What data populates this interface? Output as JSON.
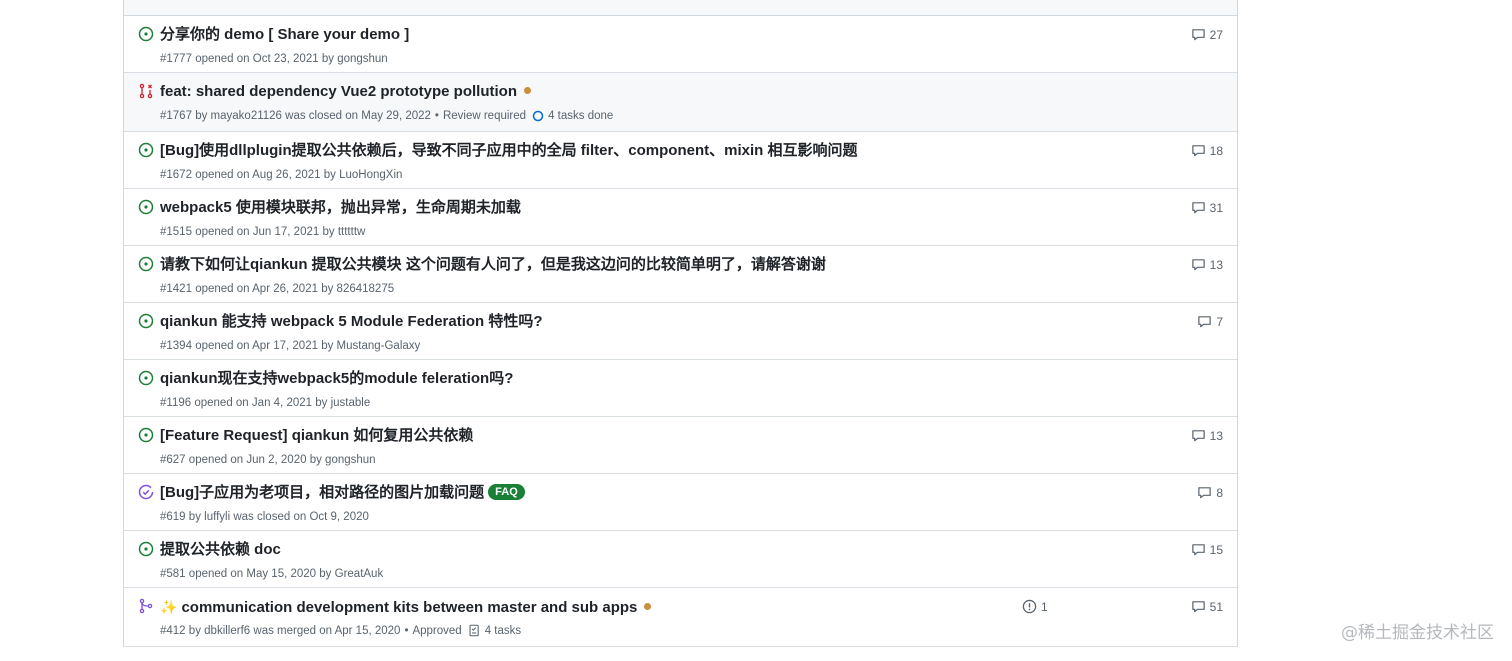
{
  "issues": [
    {
      "state": "open",
      "title": "分享你的 demo [ Share your demo ]",
      "number": "#1777",
      "verb": "opened on",
      "date": "Oct 23, 2021",
      "by": "by",
      "author": "gongshun",
      "comments": "27"
    },
    {
      "state": "pr-closed",
      "title": "feat: shared dependency Vue2 prototype pollution",
      "number": "#1767",
      "by": "by",
      "author": "mayako21126",
      "verb": "was closed on",
      "date": "May 29, 2022",
      "review": "Review required",
      "tasks": "4 tasks done",
      "has_dot": true
    },
    {
      "state": "open",
      "title": "[Bug]使用dllplugin提取公共依赖后，导致不同子应用中的全局 filter、component、mixin 相互影响问题",
      "number": "#1672",
      "verb": "opened on",
      "date": "Aug 26, 2021",
      "by": "by",
      "author": "LuoHongXin",
      "comments": "18"
    },
    {
      "state": "open",
      "title": "webpack5 使用模块联邦，抛出异常，生命周期未加载",
      "number": "#1515",
      "verb": "opened on",
      "date": "Jun 17, 2021",
      "by": "by",
      "author": "ttttttw",
      "comments": "31"
    },
    {
      "state": "open",
      "title": "请教下如何让qiankun 提取公共模块 这个问题有人问了，但是我这边问的比较简单明了，请解答谢谢",
      "number": "#1421",
      "verb": "opened on",
      "date": "Apr 26, 2021",
      "by": "by",
      "author": "826418275",
      "comments": "13"
    },
    {
      "state": "open",
      "title": "qiankun 能支持 webpack 5 Module Federation 特性吗?",
      "number": "#1394",
      "verb": "opened on",
      "date": "Apr 17, 2021",
      "by": "by",
      "author": "Mustang-Galaxy",
      "comments": "7"
    },
    {
      "state": "open",
      "title": "qiankun现在支持webpack5的module feleration吗?",
      "number": "#1196",
      "verb": "opened on",
      "date": "Jan 4, 2021",
      "by": "by",
      "author": "justable"
    },
    {
      "state": "open",
      "title": "[Feature Request] qiankun 如何复用公共依赖",
      "number": "#627",
      "verb": "opened on",
      "date": "Jun 2, 2020",
      "by": "by",
      "author": "gongshun",
      "comments": "13"
    },
    {
      "state": "closed",
      "title": "[Bug]子应用为老项目，相对路径的图片加载问题",
      "label": "FAQ",
      "number": "#619",
      "by": "by",
      "author": "luffyli",
      "verb": "was closed on",
      "date": "Oct 9, 2020",
      "comments": "8"
    },
    {
      "state": "open",
      "title": "提取公共依赖 doc",
      "number": "#581",
      "verb": "opened on",
      "date": "May 15, 2020",
      "by": "by",
      "author": "GreatAuk",
      "comments": "15"
    },
    {
      "state": "pr-merged",
      "sparkle": "✨",
      "title": "communication development kits between master and sub apps",
      "number": "#412",
      "by": "by",
      "author": "dbkillerf6",
      "verb": "was merged on",
      "date": "Apr 15, 2020",
      "review": "Approved",
      "tasks": "4 tasks",
      "linked": "1",
      "comments": "51",
      "has_dot": true
    }
  ],
  "watermark": "@稀土掘金技术社区",
  "colors": {
    "open": "#1a7f37",
    "closed": "#8250df",
    "pr_closed": "#cf222e",
    "dot": "#c98f3a"
  }
}
